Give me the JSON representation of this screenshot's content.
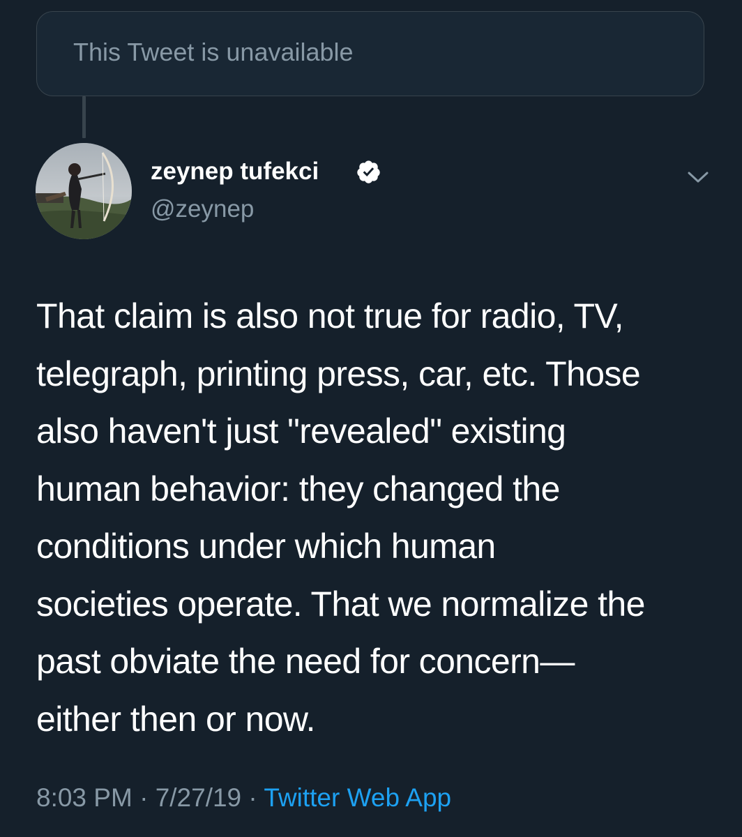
{
  "quoted": {
    "unavailable_text": "This Tweet is unavailable"
  },
  "author": {
    "display_name": "zeynep tufekci",
    "handle": "@zeynep",
    "verified": true,
    "avatar_icon": "avatar-photo-archer"
  },
  "tweet": {
    "lines": [
      "That claim is also not true for radio, TV,",
      "telegraph, printing press, car, etc. Those",
      "also haven't just \"revealed\" existing",
      "human behavior: they changed the",
      "conditions under which human",
      "societies operate. That we normalize the",
      "past obviate the need for concern—",
      "either then or now."
    ]
  },
  "meta": {
    "time": "8:03 PM",
    "separator": "·",
    "date": "7/27/19",
    "source": "Twitter Web App"
  },
  "colors": {
    "background": "#15202b",
    "secondary_text": "#8899a6",
    "accent": "#1da1f2",
    "border": "#38444d"
  },
  "icons": {
    "verified": "verified-badge-icon",
    "caret": "chevron-down-icon"
  }
}
